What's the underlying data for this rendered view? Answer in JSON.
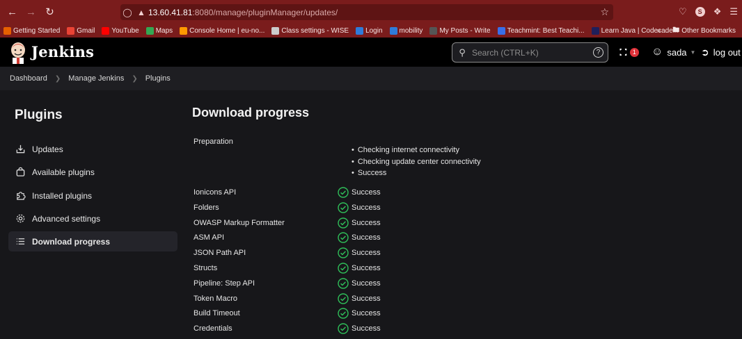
{
  "browser": {
    "url_host": "13.60.41.81",
    "url_path": ":8080/manage/pluginManager/updates/",
    "bookmarks": [
      {
        "label": "Getting Started",
        "color": "#e66000"
      },
      {
        "label": "Gmail",
        "color": "#ea4335"
      },
      {
        "label": "YouTube",
        "color": "#ff0000"
      },
      {
        "label": "Maps",
        "color": "#34a853"
      },
      {
        "label": "Console Home | eu-no...",
        "color": "#ff9900"
      },
      {
        "label": "Class settings - WISE",
        "color": "#cccccc"
      },
      {
        "label": "Login",
        "color": "#2f7bd9"
      },
      {
        "label": "mobility",
        "color": "#2f7bd9"
      },
      {
        "label": "My Posts - Write",
        "color": "#555555"
      },
      {
        "label": "Teachmint: Best Teachi...",
        "color": "#3a6ee8"
      },
      {
        "label": "Learn Java | Codecade...",
        "color": "#1f1f5a"
      }
    ],
    "other_bookmarks": "Other Bookmarks",
    "profile_letter": "S"
  },
  "header": {
    "brand": "Jenkins",
    "search_placeholder": "Search (CTRL+K)",
    "help_label": "?",
    "security_count": "1",
    "user": "sada",
    "logout": "log out"
  },
  "breadcrumb": [
    "Dashboard",
    "Manage Jenkins",
    "Plugins"
  ],
  "sidebar": {
    "title": "Plugins",
    "items": [
      {
        "label": "Updates",
        "icon": "download-icon"
      },
      {
        "label": "Available plugins",
        "icon": "shopping-bag-icon"
      },
      {
        "label": "Installed plugins",
        "icon": "puzzle-icon"
      },
      {
        "label": "Advanced settings",
        "icon": "gear-icon"
      },
      {
        "label": "Download progress",
        "icon": "list-icon",
        "active": true
      }
    ]
  },
  "main": {
    "title": "Download progress",
    "preparation": {
      "label": "Preparation",
      "steps": [
        "Checking internet connectivity",
        "Checking update center connectivity",
        "Success"
      ]
    },
    "plugins": [
      {
        "name": "Ionicons API",
        "status": "Success"
      },
      {
        "name": "Folders",
        "status": "Success"
      },
      {
        "name": "OWASP Markup Formatter",
        "status": "Success"
      },
      {
        "name": "ASM API",
        "status": "Success"
      },
      {
        "name": "JSON Path API",
        "status": "Success"
      },
      {
        "name": "Structs",
        "status": "Success"
      },
      {
        "name": "Pipeline: Step API",
        "status": "Success"
      },
      {
        "name": "Token Macro",
        "status": "Success"
      },
      {
        "name": "Build Timeout",
        "status": "Success"
      },
      {
        "name": "Credentials",
        "status": "Success"
      }
    ],
    "success_color": "#2fbf59"
  }
}
